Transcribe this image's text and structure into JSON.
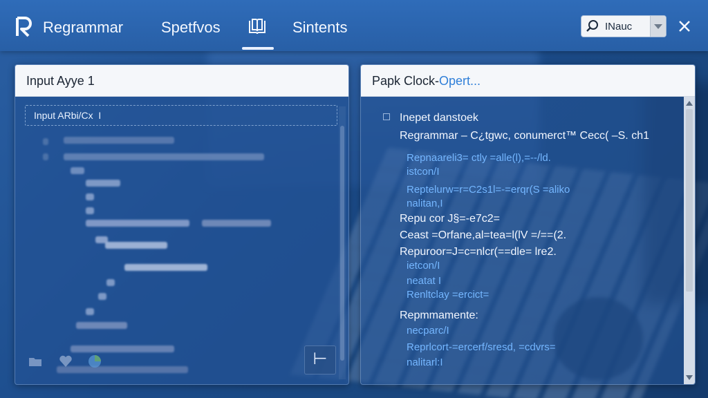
{
  "app": {
    "title": "Regrammar"
  },
  "tabs": [
    {
      "label": "Spetfvos",
      "active": false
    },
    {
      "icon": "book-icon",
      "active": true
    },
    {
      "label": "Sintents",
      "active": false
    }
  ],
  "search": {
    "value": "INauc",
    "icon": "search-icon"
  },
  "left_panel": {
    "title": "Input Ayye 1",
    "input_value": "Input ARbi/Cx  I",
    "corner_button": "⊢"
  },
  "right_panel": {
    "title_main": "Papk Clock-",
    "title_link": "Opert...",
    "lines": [
      {
        "text": "Inepet danstoek",
        "color": "white"
      },
      {
        "text": "Regrammar – C¿tgwc, conumerct™ Cecc( –S. ch1",
        "color": "white"
      },
      {
        "text": "Repnaareli3= ctly =alle(l),=--/ld.",
        "color": "blue"
      },
      {
        "text": "istcon/I",
        "color": "blue"
      },
      {
        "text": "Reptelurw=r=C2s1l=-=erqr(S =aliko",
        "color": "blue"
      },
      {
        "text": "nalitan,I",
        "color": "blue"
      },
      {
        "text": "Repu cor J§=-e7c2=",
        "color": "white"
      },
      {
        "text": "Ceast =Orfane,al=tea=l(lV =/==(2.",
        "color": "white"
      },
      {
        "text": "Repuroor=J=c=nlcr(==dle= lre2.",
        "color": "white"
      },
      {
        "text": "ietcon/I",
        "color": "blue"
      },
      {
        "text": "neatat I",
        "color": "blue"
      },
      {
        "text": "Renltclay =ercict=",
        "color": "blue"
      },
      {
        "text": "Repmmamente:",
        "color": "white"
      },
      {
        "text": "necparc/I",
        "color": "blue"
      },
      {
        "text": "Reprlcort-=ercerf/sresd, =cdvrs=",
        "color": "blue"
      },
      {
        "text": "nalitarl:I",
        "color": "blue"
      }
    ]
  },
  "colors": {
    "titlebar": "#2c66b1",
    "accent_link": "#2f7fd8",
    "code_blue": "#74b6ff",
    "code_green": "#9fd68f"
  }
}
